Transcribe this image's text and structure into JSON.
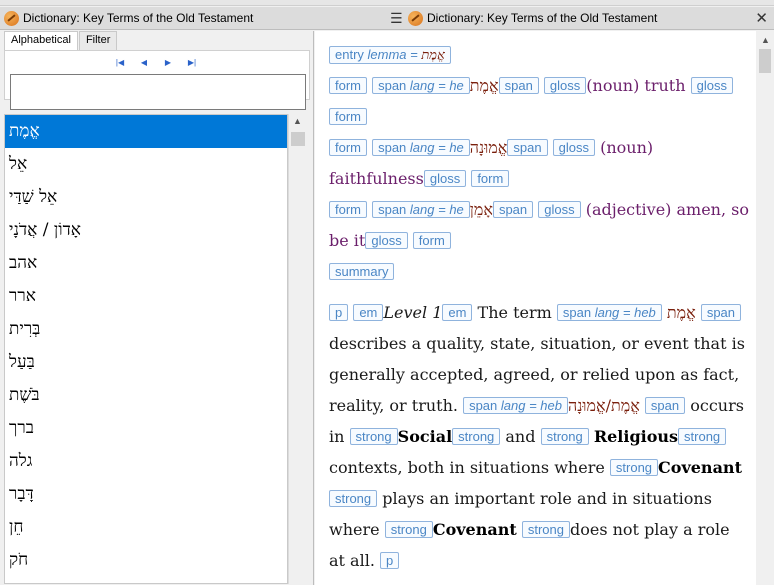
{
  "left_window": {
    "title": "Dictionary: Key Terms of the Old Testament"
  },
  "right_window": {
    "title": "Dictionary: Key Terms of the Old Testament"
  },
  "tabs": [
    "Alphabetical",
    "Filter"
  ],
  "search": {
    "value": ""
  },
  "word_list": [
    "אֱמֶת",
    "אֵל",
    "אֵל שַׁדַּי",
    "אָדוֹן / אֲדֹנָי",
    "אהב",
    "ארר",
    "בְּרִית",
    "בַּעַל",
    "בֹּשֶׁת",
    "ברך",
    "גלה",
    "דָּבָר",
    "חֵן",
    "חֹק"
  ],
  "selected_index": 0,
  "content": {
    "entry_tag": "entry",
    "entry_lemma_label": "lemma = ",
    "entry_lemma": "אֱמֶת",
    "tags": {
      "form": "form",
      "span": "span",
      "gloss": "gloss",
      "summary": "summary",
      "p": "p",
      "em": "em",
      "strong": "strong",
      "span_lang_he_prefix": "span",
      "lang_he": "lang = he",
      "lang_heb": "lang = heb"
    },
    "form1_hebrew": "אֱמֶת",
    "form1_gloss": "(noun) truth",
    "form2_hebrew": "אֱמוּנָה",
    "form2_gloss": "(noun) faithfulness",
    "form3_hebrew": "אָמֵן",
    "form3_gloss": "(adjective) amen, so be it",
    "level": "Level 1",
    "t1": "The term",
    "heb1": "אֱמֶת",
    "t2": "describes a quality, state, situation, or event that is generally accepted, agreed, or relied upon as fact, reality, or truth.",
    "heb2": "אֱמֶת/אֱמוּנָה",
    "t3": "occurs in",
    "social": "Social",
    "and": "and",
    "religious": "Religious",
    "t4": "contexts, both in situations where",
    "covenant1": "Covenant",
    "t5": "plays an important role and in situations where",
    "covenant2": "Covenant",
    "t6": "does not play a role at all."
  }
}
